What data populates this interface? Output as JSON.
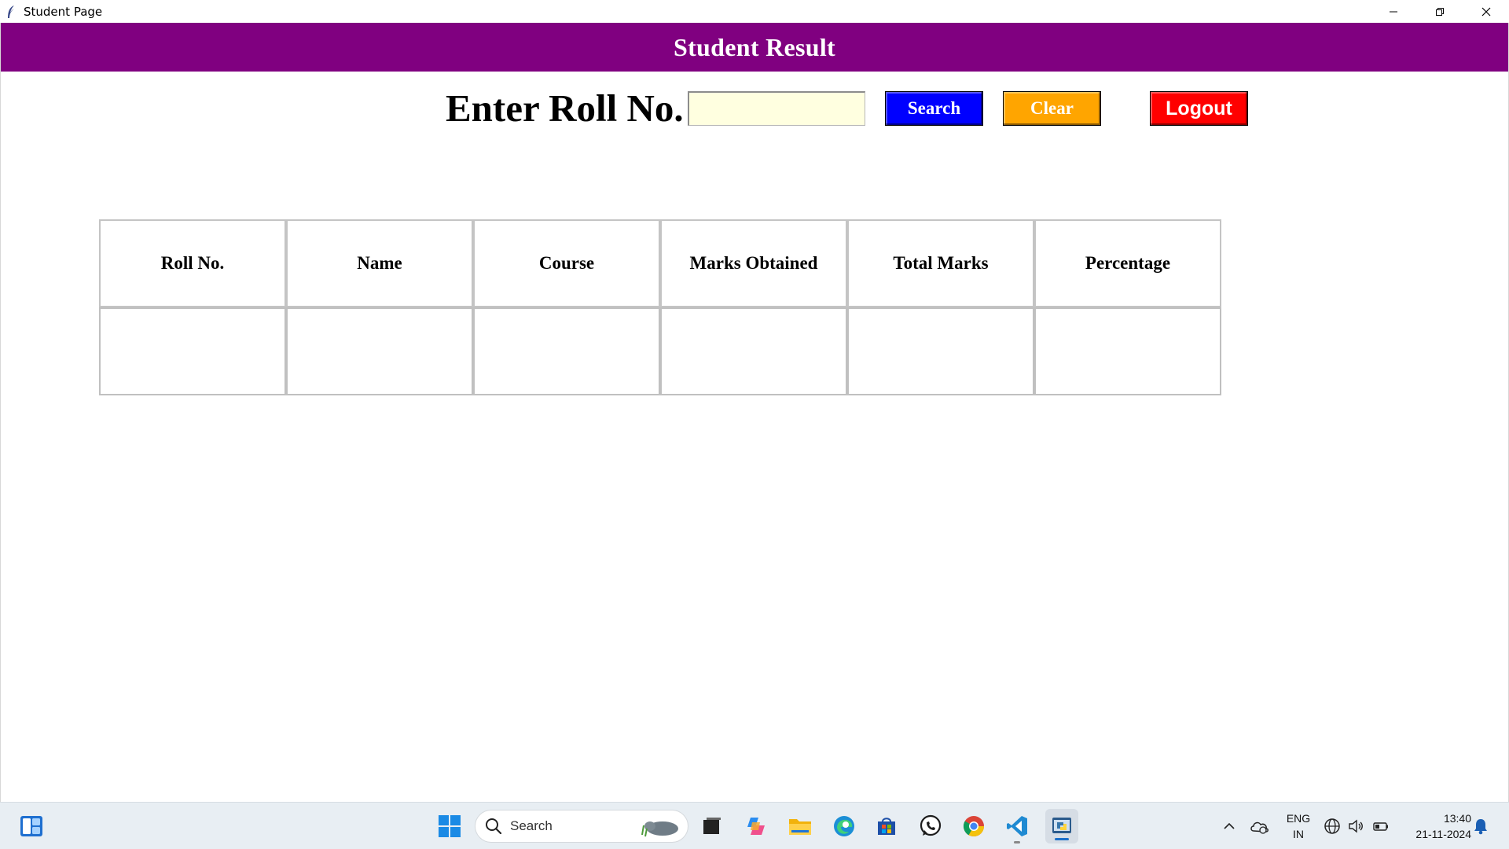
{
  "window": {
    "title": "Student Page"
  },
  "header": {
    "title": "Student Result"
  },
  "search_form": {
    "label": "Enter Roll No.",
    "roll_value": "",
    "search_label": "Search",
    "clear_label": "Clear",
    "logout_label": "Logout"
  },
  "table": {
    "headers": [
      "Roll No.",
      "Name",
      "Course",
      "Marks Obtained",
      "Total Marks",
      "Percentage"
    ],
    "row": [
      "",
      "",
      "",
      "",
      "",
      ""
    ]
  },
  "taskbar": {
    "search_placeholder": "Search",
    "language_line1": "ENG",
    "language_line2": "IN",
    "time": "13:40",
    "date": "21-11-2024"
  },
  "colors": {
    "header_bg": "#800080",
    "search_btn": "#0000ff",
    "clear_btn": "#ffa500",
    "logout_btn": "#ff0000",
    "input_bg": "#ffffe0"
  }
}
